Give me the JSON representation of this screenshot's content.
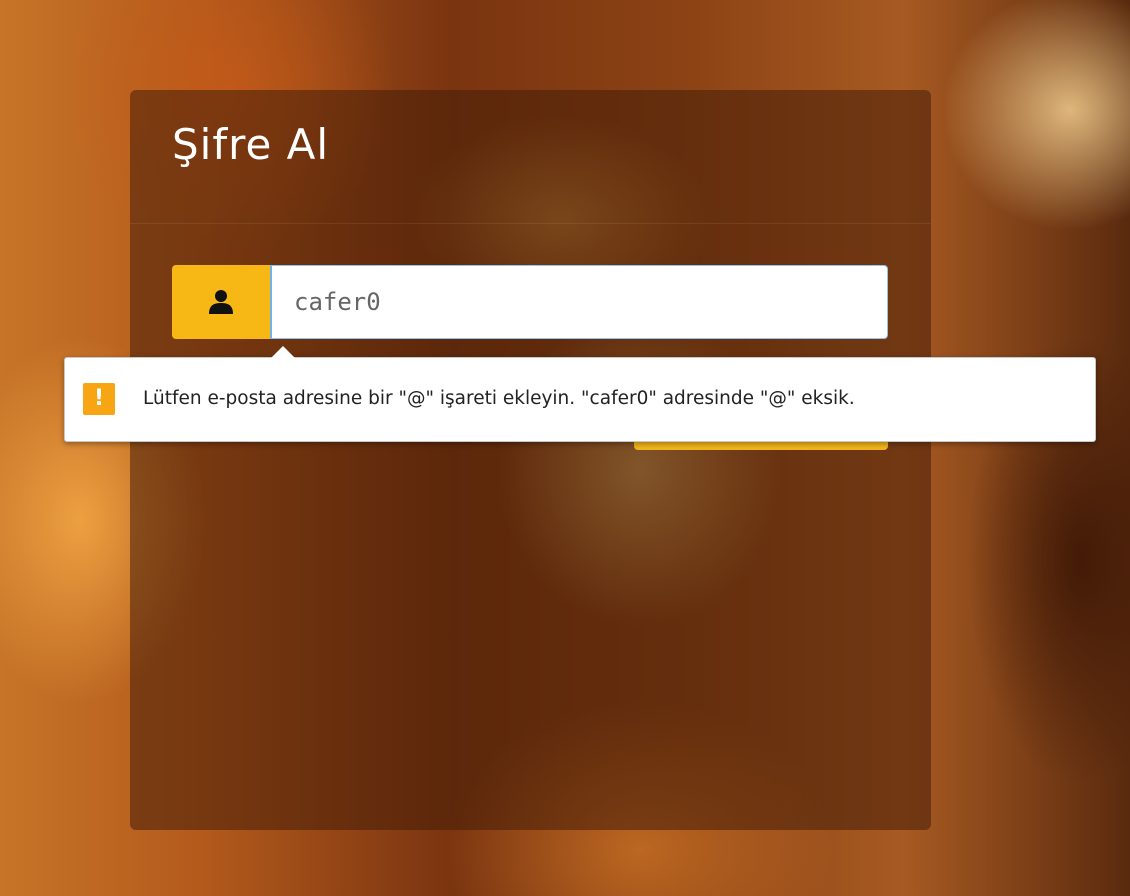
{
  "form": {
    "title": "Şifre Al",
    "email_value": "cafer0",
    "user_icon": "user-icon",
    "submit_color": "#f2b61c"
  },
  "validation": {
    "icon": "warning-icon",
    "message": "Lütfen e-posta adresine bir \"@\" işareti ekleyin. \"cafer0\" adresinde \"@\" eksik."
  },
  "colors": {
    "accent": "#f7b815",
    "warning": "#f7a513",
    "input_focus_border": "#8ec5ef"
  }
}
